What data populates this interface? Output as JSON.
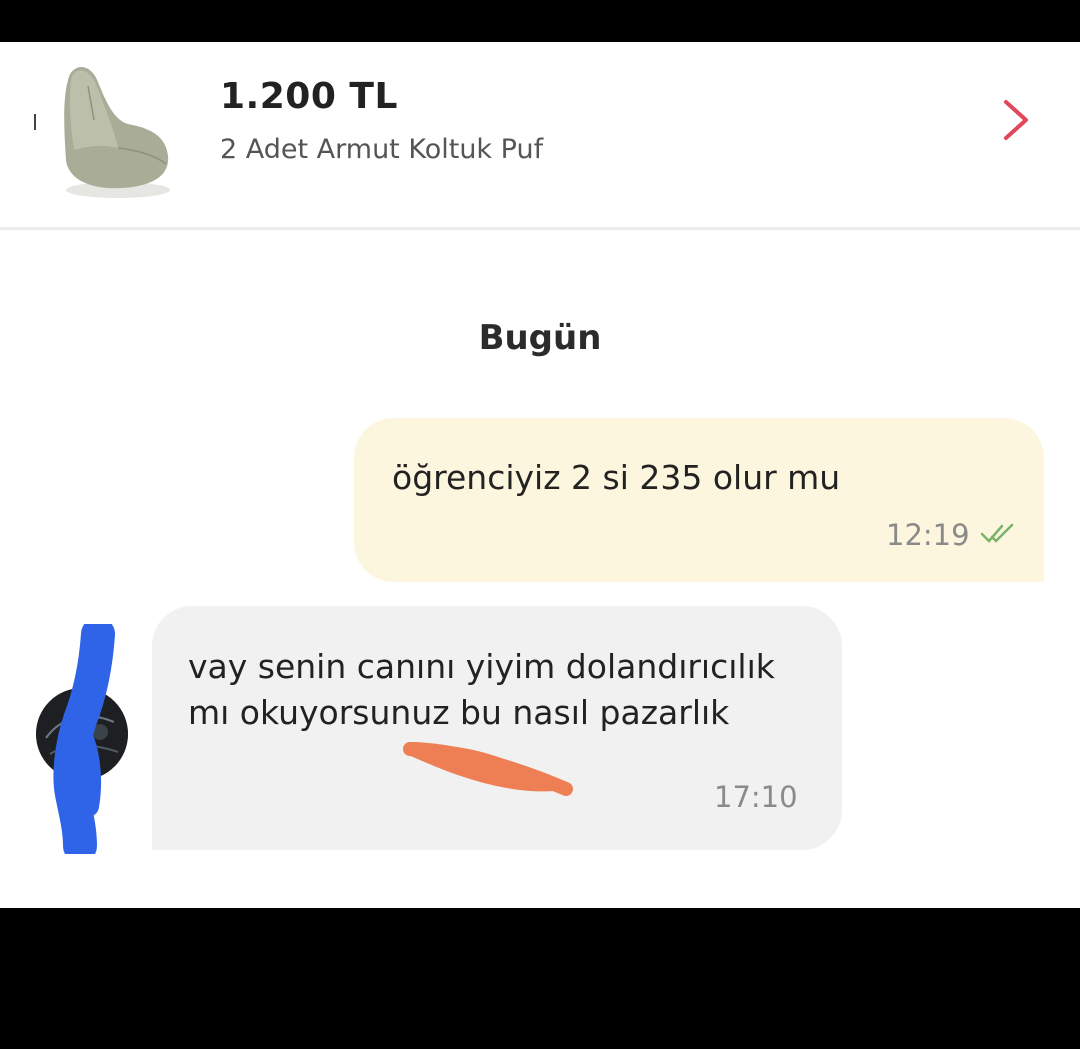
{
  "product": {
    "price": "1.200 TL",
    "name": "2 Adet Armut Koltuk Puf",
    "thumbnail_icon": "beanbag-chair-image",
    "chevron_icon": "chevron-right-icon",
    "accent_color": "#e0475a"
  },
  "chat": {
    "date_label": "Bugün",
    "messages": [
      {
        "direction": "outgoing",
        "text": "öğrenciyiz 2 si 235 olur mu",
        "time": "12:19",
        "status_icon": "double-check-icon",
        "bubble_color": "#fdf6de"
      },
      {
        "direction": "incoming",
        "text": "vay senin canını yiyim dolandırıcılık mı okuyorsunuz bu nasıl pazarlık",
        "time": "17:10",
        "bubble_color": "#f1f1f1"
      }
    ]
  }
}
